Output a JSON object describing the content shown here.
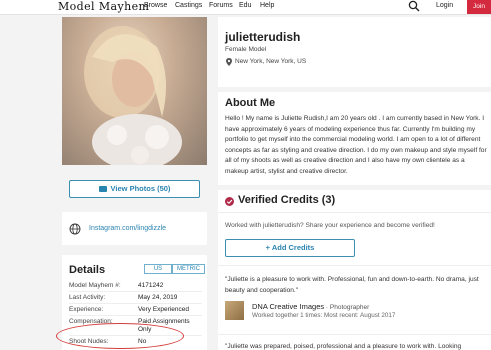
{
  "nav": {
    "logo": "Model Mayhem",
    "links": [
      "Browse",
      "Castings",
      "Forums",
      "Edu",
      "Help"
    ],
    "login": "Login",
    "join": "Join"
  },
  "profile": {
    "name": "julietterudish",
    "role": "Female Model",
    "location": "New York, New York, US",
    "photo_button": "View Photos (50)",
    "instagram": "Instagram.com/lingdizzle"
  },
  "about": {
    "title": "About Me",
    "text": "Hello ! My name is Juliette Rudish,I am 20 years old . I am currently based in New York. I have approximately 6 years of modeling experience thus far. Currently I'm building my portfolio to get myself into the commercial modeling world. I am open to a lot of different concepts as far as styling and creative direction. I do my own makeup and style myself for all of my shoots as well as creative direction and I also have my own clientele as a makeup artist, stylist and creative director."
  },
  "details": {
    "title": "Details",
    "units": [
      "US",
      "METRIC"
    ],
    "rows": [
      {
        "label": "Model Mayhem #:",
        "value": "4171242"
      },
      {
        "label": "Last Activity:",
        "value": "May 24, 2019"
      },
      {
        "label": "Experience:",
        "value": "Very Experienced"
      },
      {
        "label": "Compensation:",
        "value": "Paid Assignments Only"
      },
      {
        "label": "Shoot Nudes:",
        "value": "No"
      }
    ]
  },
  "credits": {
    "title": "Verified Credits (3)",
    "prompt": "Worked with julietterudish? Share your experience and become verified!",
    "add_button": "+ Add Credits",
    "quote1": "\"Juliette is a pleasure to work with. Professional, fun and down-to-earth. No drama, just beauty and cooperation.\"",
    "credit_name": "DNA Creative Images",
    "credit_role": " · Photographer",
    "credit_meta": "Worked together 1 times: Most recent: August 2017",
    "quote2": "\"Juliette was prepared, poised, professional and a pleasure to work with. Looking"
  },
  "colors": {
    "accent": "#2a84b0",
    "join": "#d42a3f",
    "verified": "#b02a4a",
    "highlight_circle": "#d43c3c"
  }
}
